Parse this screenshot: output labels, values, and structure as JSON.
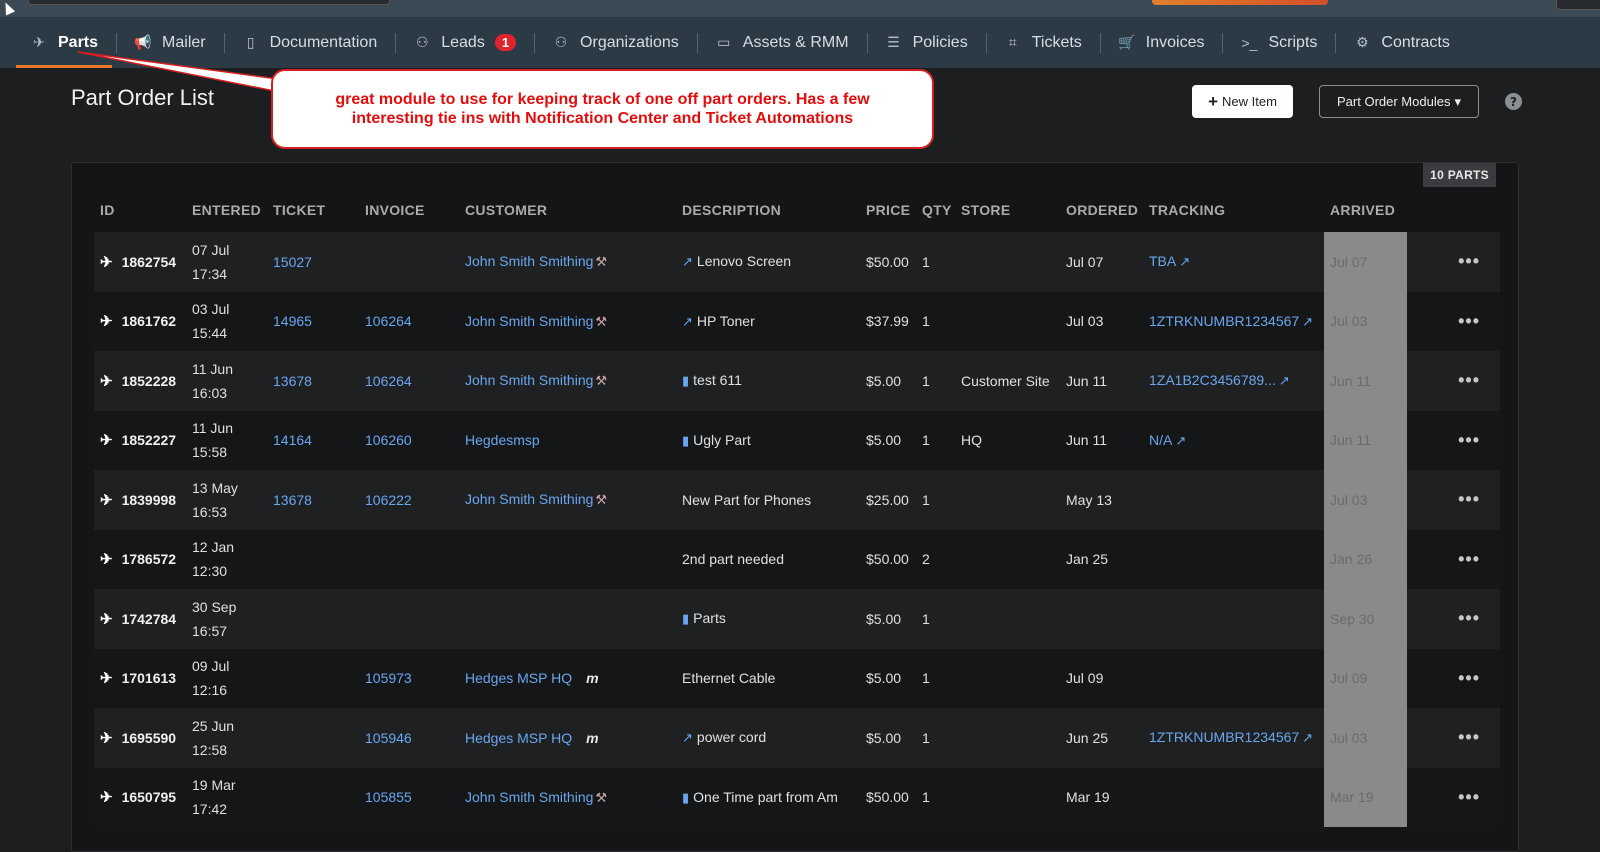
{
  "nav": {
    "items": [
      {
        "label": "Parts",
        "icon": "plane-icon",
        "glyph": "✈"
      },
      {
        "label": "Mailer",
        "icon": "megaphone-icon",
        "glyph": "📢"
      },
      {
        "label": "Documentation",
        "icon": "book-icon",
        "glyph": "▯"
      },
      {
        "label": "Leads",
        "icon": "add-user-icon",
        "glyph": "⚇"
      },
      {
        "label": "Organizations",
        "icon": "user-icon",
        "glyph": "⚇"
      },
      {
        "label": "Assets & RMM",
        "icon": "monitor-icon",
        "glyph": "▭"
      },
      {
        "label": "Policies",
        "icon": "policy-icon",
        "glyph": "☰"
      },
      {
        "label": "Tickets",
        "icon": "tag-icon",
        "glyph": "⌗"
      },
      {
        "label": "Invoices",
        "icon": "cart-icon",
        "glyph": "🛒"
      },
      {
        "label": "Scripts",
        "icon": "terminal-icon",
        "glyph": ">_"
      },
      {
        "label": "Contracts",
        "icon": "handshake-icon",
        "glyph": "⚙"
      }
    ],
    "leads_badge": "1"
  },
  "page": {
    "title": "Part Order List",
    "new_item_label": "New Item",
    "modules_label": "Part Order Modules",
    "help": "?"
  },
  "callout": {
    "text": "great module to use for keeping track of one off part orders. Has a few interesting tie ins with Notification Center and Ticket Automations"
  },
  "table": {
    "count_label": "10 PARTS",
    "headers": {
      "id": "ID",
      "entered": "ENTERED",
      "ticket": "TICKET",
      "invoice": "INVOICE",
      "customer": "CUSTOMER",
      "description": "DESCRIPTION",
      "price": "PRICE",
      "qty": "QTY",
      "store": "STORE",
      "ordered": "ORDERED",
      "tracking": "TRACKING",
      "arrived": "ARRIVED"
    },
    "rows": [
      {
        "id": "1862754",
        "entered_date": "07 Jul",
        "entered_time": "17:34",
        "ticket": "15027",
        "invoice": "",
        "customer": "John Smith Smithing",
        "customer_icon": "tools",
        "desc_icon": "external",
        "description": "Lenovo Screen",
        "price": "$50.00",
        "qty": "1",
        "store": "",
        "ordered": "Jul 07",
        "tracking": "TBA",
        "arrived": "Jul 07"
      },
      {
        "id": "1861762",
        "entered_date": "03 Jul",
        "entered_time": "15:44",
        "ticket": "14965",
        "invoice": "106264",
        "customer": "John Smith Smithing",
        "customer_icon": "tools",
        "desc_icon": "external",
        "description": "HP Toner",
        "price": "$37.99",
        "qty": "1",
        "store": "",
        "ordered": "Jul 03",
        "tracking": "1ZTRKNUMBR1234567",
        "arrived": "Jul 03"
      },
      {
        "id": "1852228",
        "entered_date": "11 Jun",
        "entered_time": "16:03",
        "ticket": "13678",
        "invoice": "106264",
        "customer": "John Smith Smithing",
        "customer_icon": "tools",
        "desc_icon": "clipboard",
        "description": "test 611",
        "price": "$5.00",
        "qty": "1",
        "store": "Customer Site",
        "ordered": "Jun 11",
        "tracking": "1ZA1B2C3456789...",
        "arrived": "Jun 11"
      },
      {
        "id": "1852227",
        "entered_date": "11 Jun",
        "entered_time": "15:58",
        "ticket": "14164",
        "invoice": "106260",
        "customer": "Hegdesmsp",
        "customer_icon": "",
        "desc_icon": "clipboard",
        "description": "Ugly Part",
        "price": "$5.00",
        "qty": "1",
        "store": "HQ",
        "ordered": "Jun 11",
        "tracking": "N/A",
        "arrived": "Jun 11"
      },
      {
        "id": "1839998",
        "entered_date": "13 May",
        "entered_time": "16:53",
        "ticket": "13678",
        "invoice": "106222",
        "customer": "John Smith Smithing",
        "customer_icon": "tools",
        "desc_icon": "",
        "description": "New Part for Phones",
        "price": "$25.00",
        "qty": "1",
        "store": "",
        "ordered": "May 13",
        "tracking": "",
        "arrived": "Jul 03"
      },
      {
        "id": "1786572",
        "entered_date": "12 Jan",
        "entered_time": "12:30",
        "ticket": "",
        "invoice": "",
        "customer": "",
        "customer_icon": "",
        "desc_icon": "",
        "description": "2nd part needed",
        "price": "$50.00",
        "qty": "2",
        "store": "",
        "ordered": "Jan 25",
        "tracking": "",
        "arrived": "Jan 26"
      },
      {
        "id": "1742784",
        "entered_date": "30 Sep",
        "entered_time": "16:57",
        "ticket": "",
        "invoice": "",
        "customer": "",
        "customer_icon": "",
        "desc_icon": "clipboard",
        "description": "Parts",
        "price": "$5.00",
        "qty": "1",
        "store": "",
        "ordered": "",
        "tracking": "",
        "arrived": "Sep 30"
      },
      {
        "id": "1701613",
        "entered_date": "09 Jul",
        "entered_time": "12:16",
        "ticket": "",
        "invoice": "105973",
        "customer": "Hedges MSP HQ",
        "customer_icon": "m",
        "desc_icon": "",
        "description": "Ethernet Cable",
        "price": "$5.00",
        "qty": "1",
        "store": "",
        "ordered": "Jul 09",
        "tracking": "",
        "arrived": "Jul 09"
      },
      {
        "id": "1695590",
        "entered_date": "25 Jun",
        "entered_time": "12:58",
        "ticket": "",
        "invoice": "105946",
        "customer": "Hedges MSP HQ",
        "customer_icon": "m",
        "desc_icon": "external",
        "description": "power cord",
        "price": "$5.00",
        "qty": "1",
        "store": "",
        "ordered": "Jun 25",
        "tracking": "1ZTRKNUMBR1234567",
        "arrived": "Jul 03"
      },
      {
        "id": "1650795",
        "entered_date": "19 Mar",
        "entered_time": "17:42",
        "ticket": "",
        "invoice": "105855",
        "customer": "John Smith Smithing",
        "customer_icon": "tools",
        "desc_icon": "clipboard",
        "description": "One Time part from Am",
        "price": "$50.00",
        "qty": "1",
        "store": "",
        "ordered": "Mar 19",
        "tracking": "",
        "arrived": "Mar 19"
      }
    ]
  }
}
